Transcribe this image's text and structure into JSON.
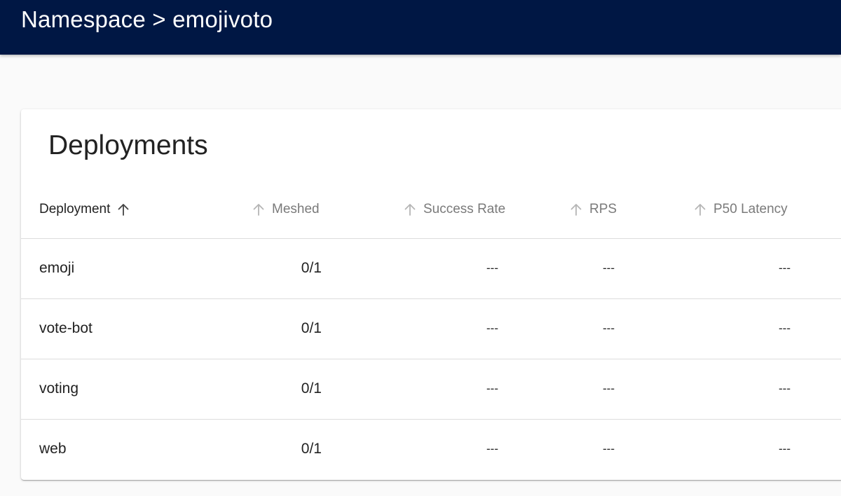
{
  "header": {
    "breadcrumb": "Namespace > emojivoto"
  },
  "card": {
    "title": "Deployments"
  },
  "table": {
    "columns": {
      "deployment": "Deployment",
      "meshed": "Meshed",
      "success_rate": "Success Rate",
      "rps": "RPS",
      "p50_latency": "P50 Latency"
    },
    "sort": {
      "column": "deployment",
      "direction": "ascending"
    },
    "rows": [
      {
        "name": "emoji",
        "meshed": "0/1",
        "success_rate": "---",
        "rps": "---",
        "p50_latency": "---"
      },
      {
        "name": "vote-bot",
        "meshed": "0/1",
        "success_rate": "---",
        "rps": "---",
        "p50_latency": "---"
      },
      {
        "name": "voting",
        "meshed": "0/1",
        "success_rate": "---",
        "rps": "---",
        "p50_latency": "---"
      },
      {
        "name": "web",
        "meshed": "0/1",
        "success_rate": "---",
        "rps": "---",
        "p50_latency": "---"
      }
    ]
  },
  "colors": {
    "topbar": "#001744",
    "background": "#fafafa",
    "card": "#ffffff",
    "divider": "#dcdcdc",
    "active_header_text": "#222222",
    "inactive_header_text": "#7a7a7a"
  },
  "icons": {
    "sort": "arrow-up-icon"
  }
}
